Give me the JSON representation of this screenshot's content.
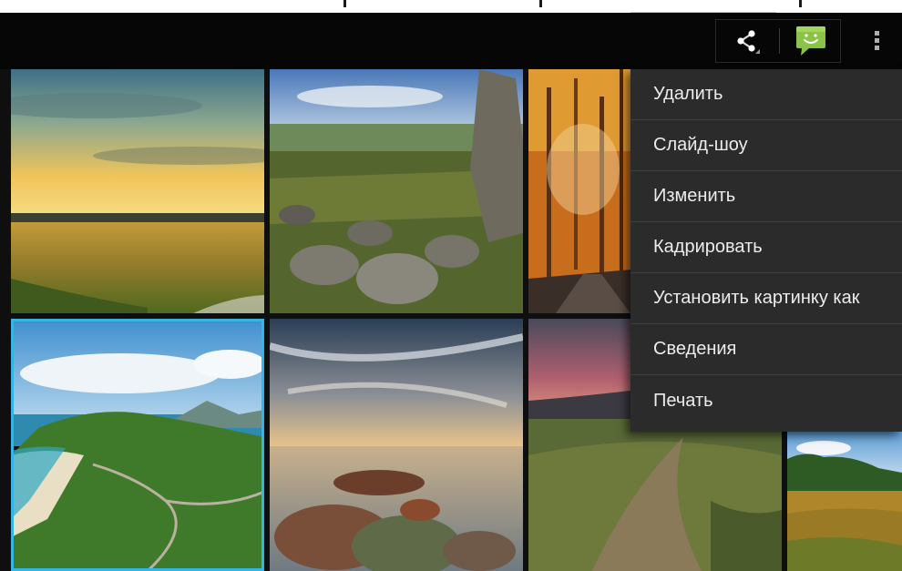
{
  "action_bar": {
    "share_icon": "share-icon",
    "message_icon": "message-app-icon",
    "overflow_icon": "overflow-menu-icon",
    "accent_color": "#33b5e5"
  },
  "gallery": {
    "tiles": [
      {
        "subject": "sunset-meadow"
      },
      {
        "subject": "rocky-valley"
      },
      {
        "subject": "autumn-forest-road"
      },
      {
        "subject": "coastal-hills"
      },
      {
        "subject": "rocks-by-sea-dramatic-sky"
      },
      {
        "subject": "mountain-path-dusk"
      },
      {
        "subject": "field-and-trees"
      }
    ],
    "selected_index": 3
  },
  "menu": {
    "items": [
      {
        "label": "Удалить"
      },
      {
        "label": "Слайд-шоу"
      },
      {
        "label": "Изменить"
      },
      {
        "label": "Кадрировать"
      },
      {
        "label": "Установить картинку как"
      },
      {
        "label": "Сведения"
      },
      {
        "label": "Печать"
      }
    ]
  }
}
